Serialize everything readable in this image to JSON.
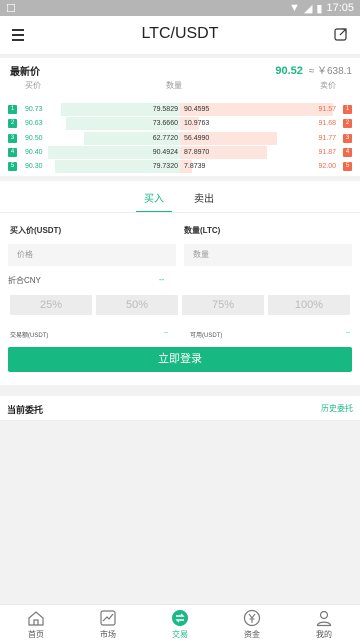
{
  "status_bar": {
    "time": "17:05"
  },
  "header": {
    "title": "LTC/USDT"
  },
  "orderbook": {
    "latest_label": "最新价",
    "latest_price": "90.52",
    "cny_price": "≈ ￥638.1",
    "col_buy": "买价",
    "col_qty": "数量",
    "col_sell": "卖价",
    "rows": [
      {
        "rank": "1",
        "bid": "90.73",
        "bid_qty": "79.5829",
        "ask_qty": "90.4595",
        "ask": "91.57",
        "bid_depth": 0.9,
        "ask_depth": 0.98
      },
      {
        "rank": "2",
        "bid": "90.63",
        "bid_qty": "73.6660",
        "ask_qty": "10.9763",
        "ask": "91.68",
        "bid_depth": 0.86,
        "ask_depth": 0.12
      },
      {
        "rank": "3",
        "bid": "90.50",
        "bid_qty": "62.7720",
        "ask_qty": "56.4990",
        "ask": "91.77",
        "bid_depth": 0.73,
        "ask_depth": 0.62
      },
      {
        "rank": "4",
        "bid": "90.40",
        "bid_qty": "90.4924",
        "ask_qty": "87.8970",
        "ask": "91.87",
        "bid_depth": 1.0,
        "ask_depth": 0.56
      },
      {
        "rank": "5",
        "bid": "90.30",
        "bid_qty": "79.7320",
        "ask_qty": "7.8739",
        "ask": "92.00",
        "bid_depth": 0.95,
        "ask_depth": 0.08
      }
    ]
  },
  "trade": {
    "tab_buy": "买入",
    "tab_sell": "卖出",
    "price_label": "买入价(USDT)",
    "qty_label": "数量(LTC)",
    "price_placeholder": "价格",
    "qty_placeholder": "数量",
    "cny_label": "折合CNY",
    "cny_value": "--",
    "pct": [
      "25%",
      "50%",
      "75%",
      "100%"
    ],
    "amount_label": "交易额(USDT)",
    "amount_value": "--",
    "avail_label": "可用(USDT)",
    "avail_value": "--",
    "login_button": "立即登录"
  },
  "entrust": {
    "title": "当前委托",
    "history": "历史委托"
  },
  "nav": {
    "home": "首页",
    "market": "市场",
    "trade": "交易",
    "assets": "资金",
    "mine": "我的"
  },
  "colors": {
    "accent": "#1ab985",
    "sell": "#f26a4b"
  }
}
